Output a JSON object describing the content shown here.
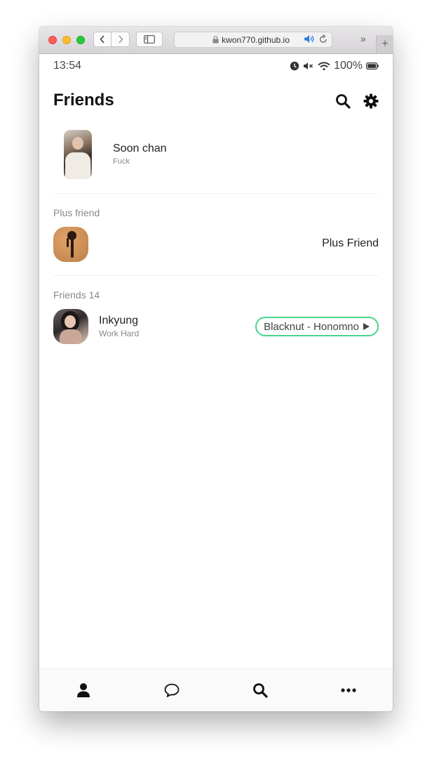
{
  "browser": {
    "url": "kwon770.github.io",
    "icons": [
      "back-icon",
      "forward-icon",
      "sidebar-icon",
      "lock-icon",
      "speaker-icon",
      "reload-icon",
      "overflow-icon",
      "new-tab-icon"
    ]
  },
  "status_bar": {
    "time": "13:54",
    "battery": "100%"
  },
  "header": {
    "title": "Friends"
  },
  "me": {
    "name": "Soon chan",
    "status": "Fuck"
  },
  "plus_friend": {
    "section_label": "Plus friend",
    "name": "Plus Friend"
  },
  "friends": {
    "section_label": "Friends 14",
    "items": [
      {
        "name": "Inkyung",
        "status": "Work Hard",
        "music": "Blacknut - Honomno"
      }
    ]
  },
  "tabbar": {
    "items": [
      "user-icon",
      "chat-icon",
      "search-icon",
      "more-icon"
    ]
  },
  "colors": {
    "music_border": "#49d58a",
    "text_dark": "#222222",
    "text_muted": "#888888"
  }
}
